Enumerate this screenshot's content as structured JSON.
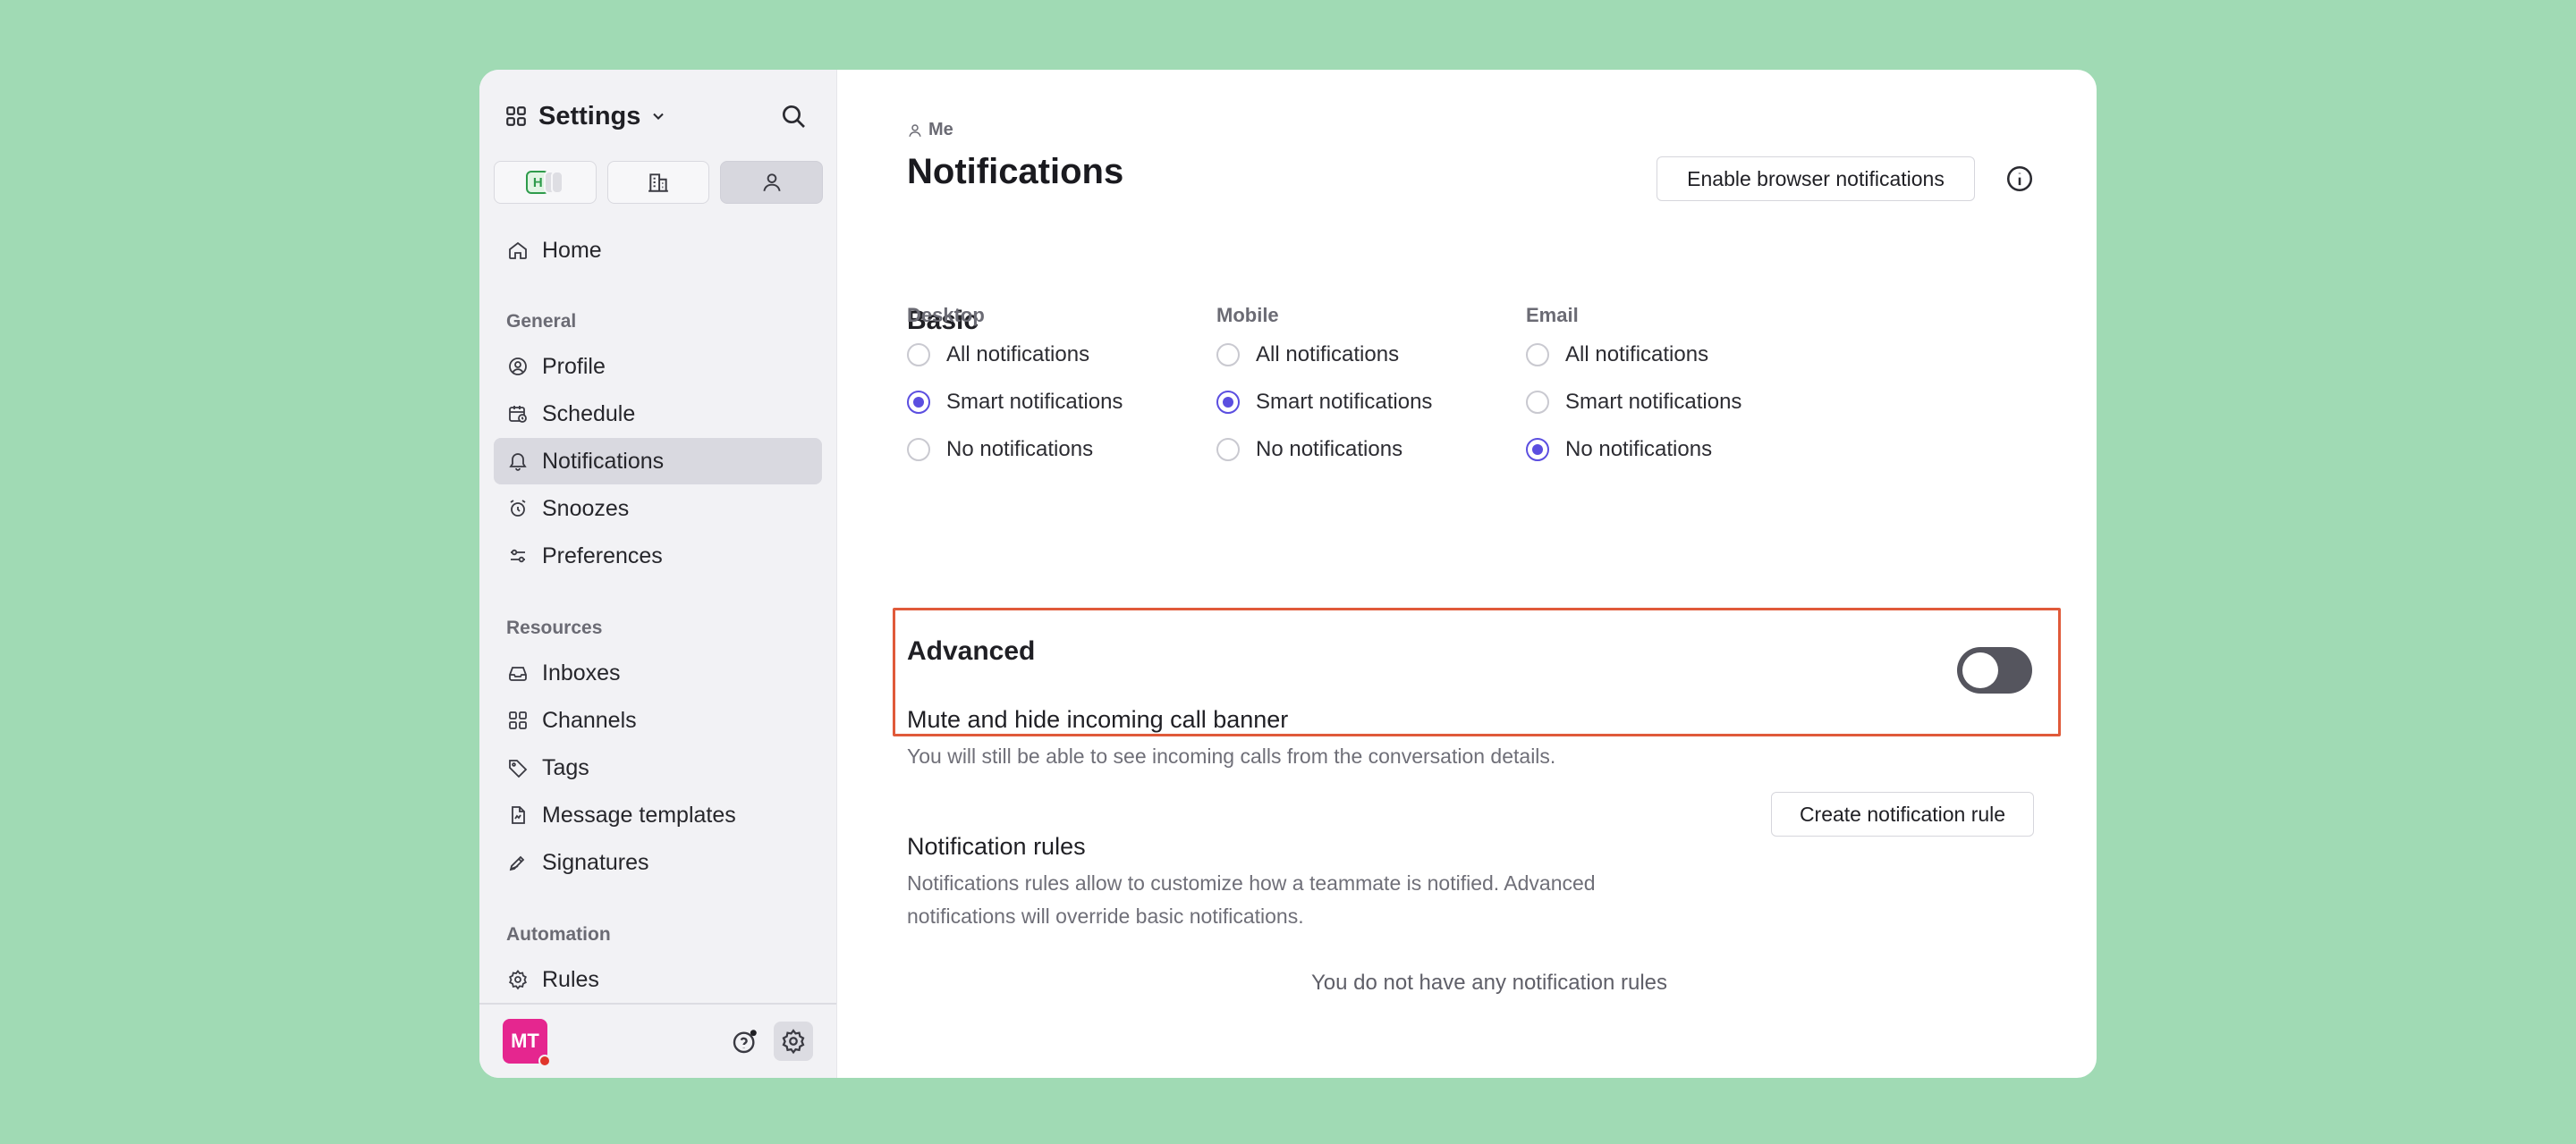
{
  "sidebar": {
    "title": "Settings",
    "segments": {
      "first_badge": "H"
    },
    "home": "Home",
    "sections": [
      {
        "label": "General",
        "items": [
          "Profile",
          "Schedule",
          "Notifications",
          "Snoozes",
          "Preferences"
        ]
      },
      {
        "label": "Resources",
        "items": [
          "Inboxes",
          "Channels",
          "Tags",
          "Message templates",
          "Signatures"
        ]
      },
      {
        "label": "Automation",
        "items": [
          "Rules"
        ]
      }
    ],
    "active_item": "Notifications",
    "user_initials": "MT",
    "avatar_color": "#e5268f"
  },
  "main": {
    "breadcrumb": "Me",
    "title": "Notifications",
    "enable_button": "Enable browser notifications",
    "basic": {
      "heading": "Basic",
      "columns": [
        {
          "label": "Desktop",
          "options": [
            "All notifications",
            "Smart notifications",
            "No notifications"
          ],
          "selected": 1
        },
        {
          "label": "Mobile",
          "options": [
            "All notifications",
            "Smart notifications",
            "No notifications"
          ],
          "selected": 1
        },
        {
          "label": "Email",
          "options": [
            "All notifications",
            "Smart notifications",
            "No notifications"
          ],
          "selected": 2
        }
      ]
    },
    "advanced": {
      "heading": "Advanced",
      "mute_title": "Mute and hide incoming call banner",
      "mute_desc": "You will still be able to see incoming calls from the conversation details.",
      "mute_enabled": false,
      "rules_title": "Notification rules",
      "rules_desc_1": "Notifications rules allow to customize how a teammate is notified. Advanced",
      "rules_desc_2": "notifications will override basic notifications.",
      "create_button": "Create notification rule",
      "empty_text": "You do not have any notification rules"
    },
    "accent_color": "#5b4ee0",
    "highlight_color": "#e05a3a"
  }
}
